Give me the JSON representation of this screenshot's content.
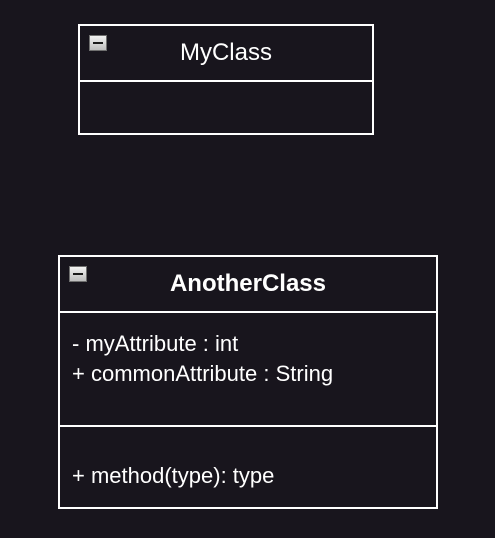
{
  "classes": [
    {
      "name": "MyClass",
      "attributes": [],
      "methods": []
    },
    {
      "name": "AnotherClass",
      "attributes": [
        "- myAttribute : int",
        "+ commonAttribute : String"
      ],
      "methods": [
        "+ method(type): type"
      ]
    }
  ]
}
